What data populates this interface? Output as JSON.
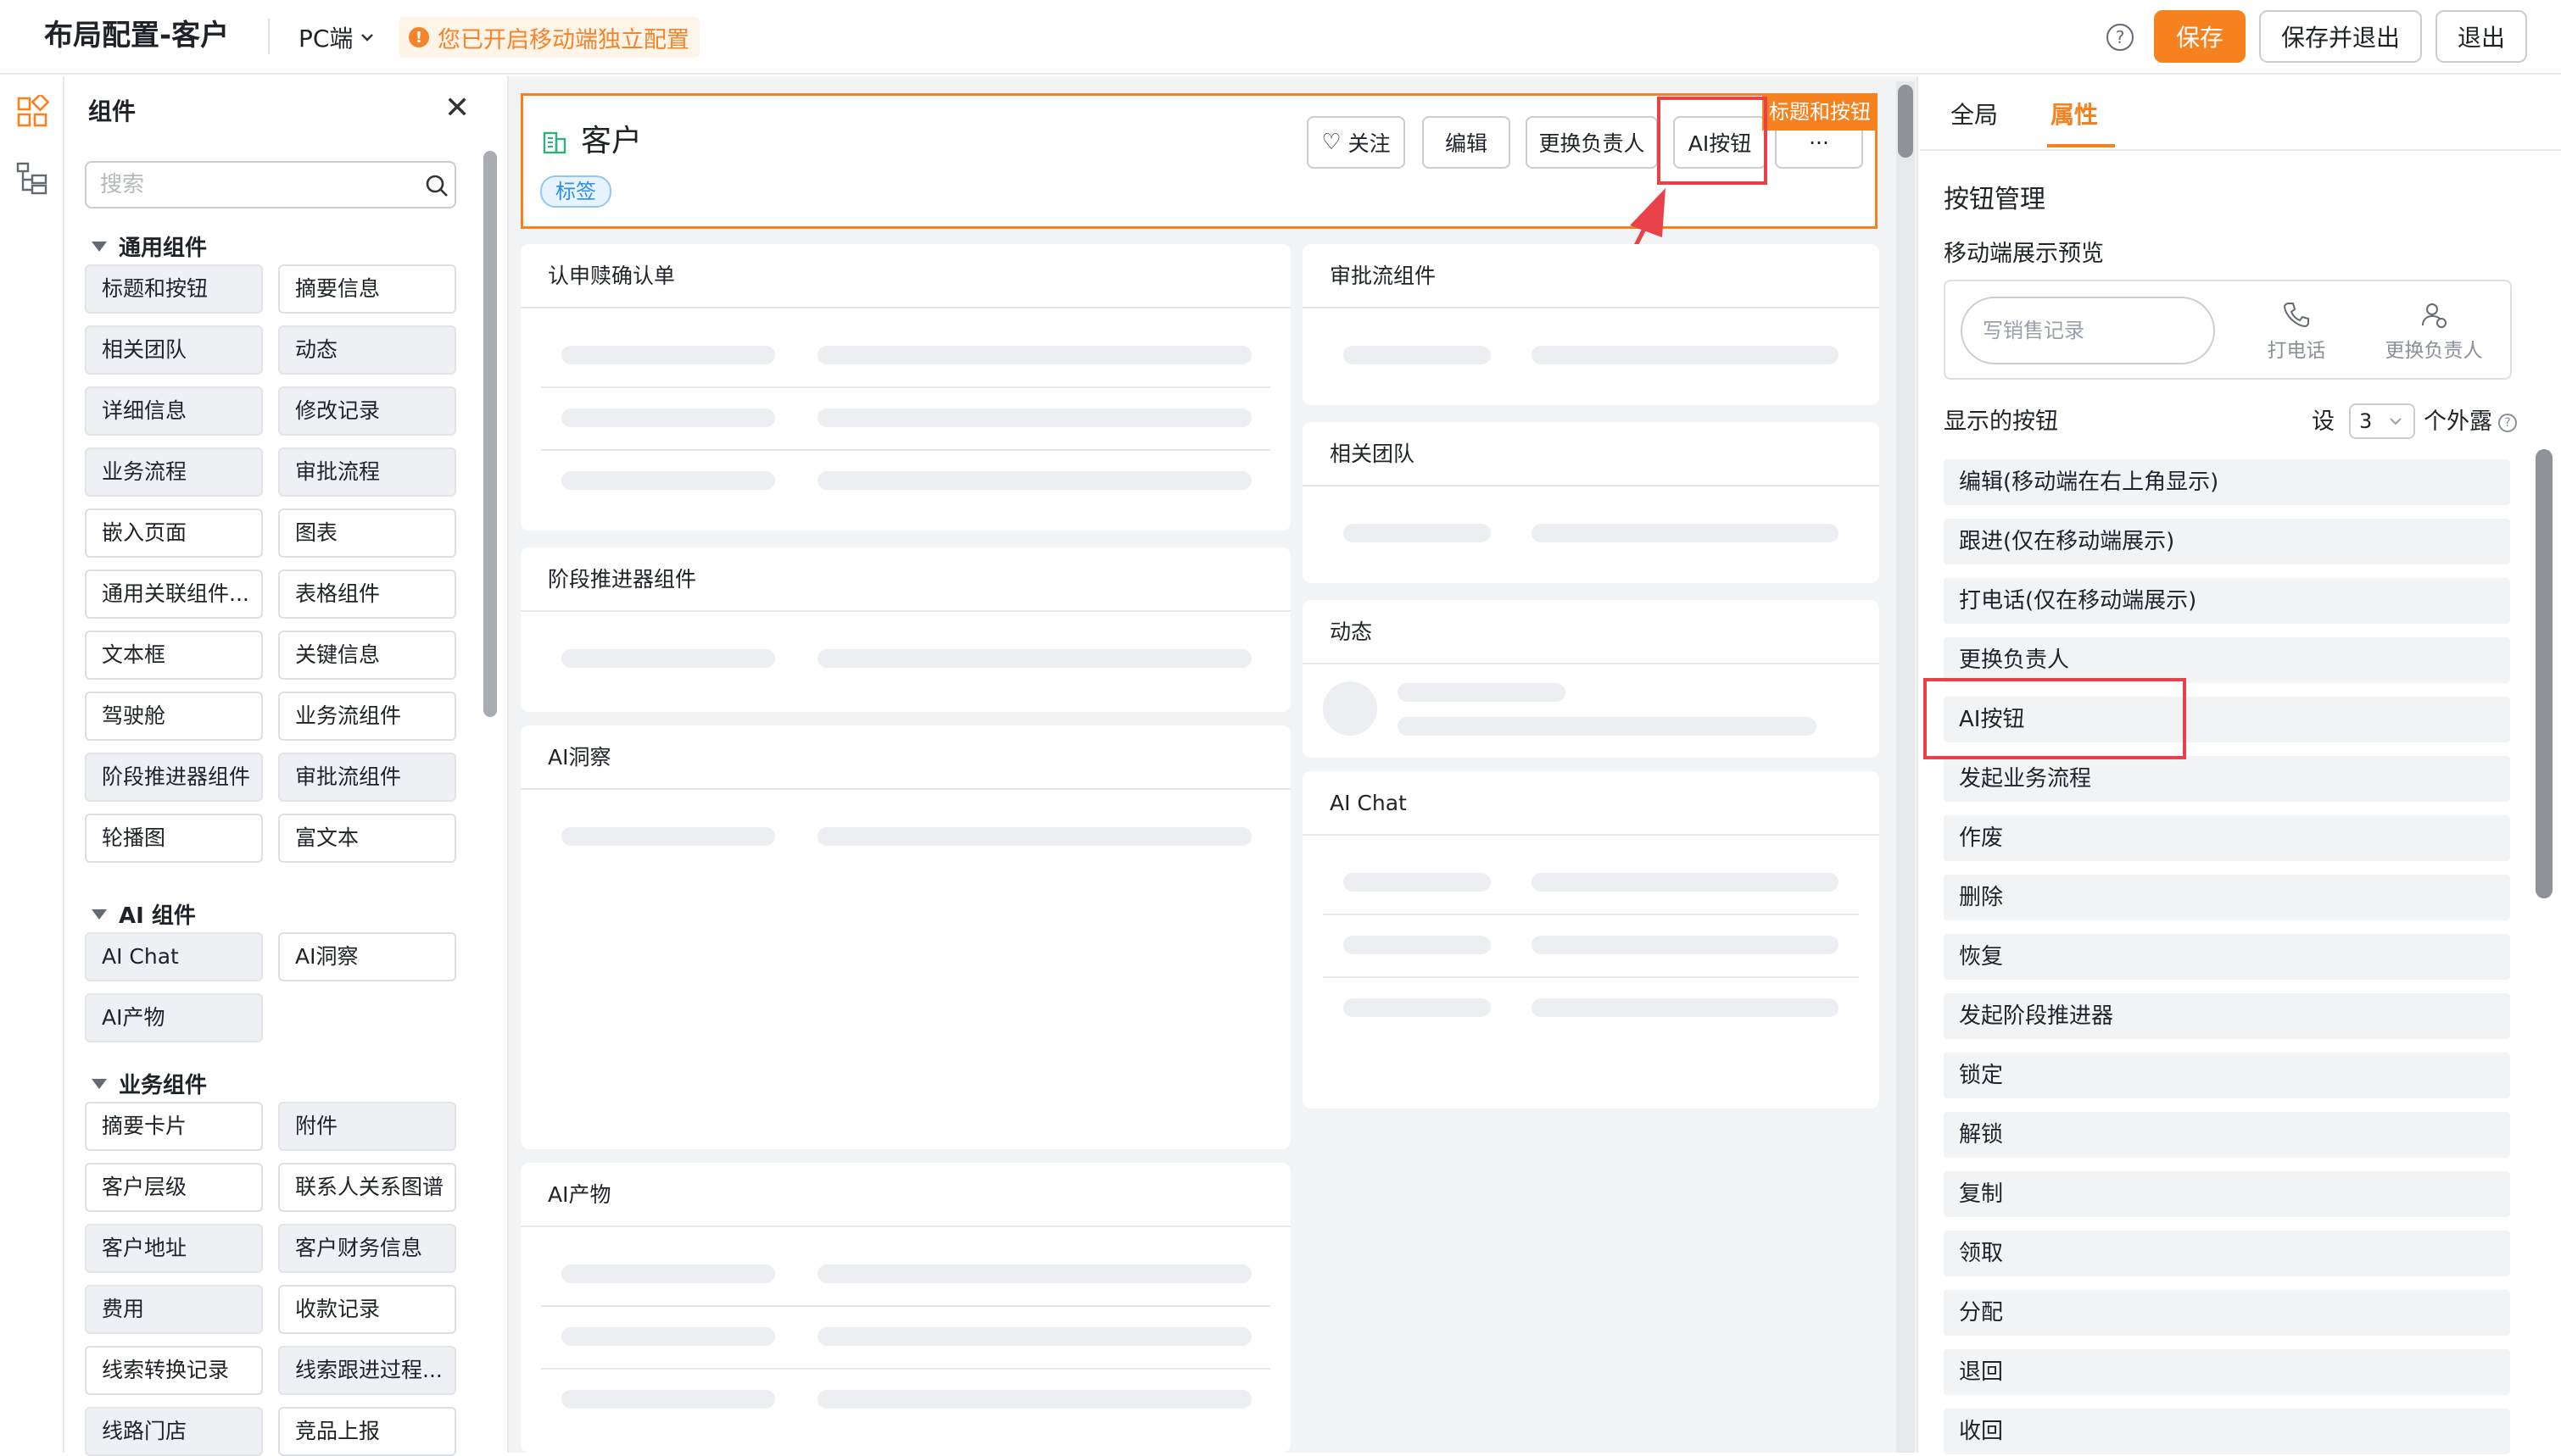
{
  "topbar": {
    "title": "布局配置-客户",
    "platform": "PC端",
    "mobile_notice": "您已开启移动端独立配置",
    "buttons": {
      "save": "保存",
      "save_exit": "保存并退出",
      "exit": "退出"
    },
    "colors": {
      "accent": "#f5821f",
      "warn_bg": "#fff4e8"
    }
  },
  "left_panel": {
    "title": "组件",
    "search_placeholder": "搜索",
    "groups": [
      {
        "name": "通用组件",
        "items": [
          {
            "label": "标题和按钮",
            "used": true
          },
          {
            "label": "摘要信息",
            "used": false
          },
          {
            "label": "相关团队",
            "used": true
          },
          {
            "label": "动态",
            "used": true
          },
          {
            "label": "详细信息",
            "used": true
          },
          {
            "label": "修改记录",
            "used": true
          },
          {
            "label": "业务流程",
            "used": true
          },
          {
            "label": "审批流程",
            "used": true
          },
          {
            "label": "嵌入页面",
            "used": false
          },
          {
            "label": "图表",
            "used": false
          },
          {
            "label": "通用关联组件...",
            "used": false
          },
          {
            "label": "表格组件",
            "used": false
          },
          {
            "label": "文本框",
            "used": false
          },
          {
            "label": "关键信息",
            "used": false
          },
          {
            "label": "驾驶舱",
            "used": false
          },
          {
            "label": "业务流组件",
            "used": false
          },
          {
            "label": "阶段推进器组件",
            "used": true
          },
          {
            "label": "审批流组件",
            "used": true
          },
          {
            "label": "轮播图",
            "used": false
          },
          {
            "label": "富文本",
            "used": false
          }
        ]
      },
      {
        "name": "AI 组件",
        "items": [
          {
            "label": "AI Chat",
            "used": true
          },
          {
            "label": "AI洞察",
            "used": false
          },
          {
            "label": "AI产物",
            "used": true
          }
        ]
      },
      {
        "name": "业务组件",
        "items": [
          {
            "label": "摘要卡片",
            "used": false
          },
          {
            "label": "附件",
            "used": true
          },
          {
            "label": "客户层级",
            "used": false
          },
          {
            "label": "联系人关系图谱",
            "used": false
          },
          {
            "label": "客户地址",
            "used": true
          },
          {
            "label": "客户财务信息",
            "used": true
          },
          {
            "label": "费用",
            "used": true
          },
          {
            "label": "收款记录",
            "used": false
          },
          {
            "label": "线索转换记录",
            "used": false
          },
          {
            "label": "线索跟进过程...",
            "used": true
          },
          {
            "label": "线路门店",
            "used": true
          },
          {
            "label": "竞品上报",
            "used": false
          }
        ]
      }
    ]
  },
  "canvas": {
    "header": {
      "name": "客户",
      "tag": "标签",
      "badge": "标题和按钮",
      "buttons": {
        "follow": "关注",
        "edit": "编辑",
        "change_owner": "更换负责人",
        "ai": "AI按钮",
        "more": "···"
      }
    },
    "cards": {
      "left1": "认申赎确认单",
      "left2": "阶段推进器组件",
      "left3": "AI洞察",
      "left4": "AI产物",
      "right1": "审批流组件",
      "right2": "相关团队",
      "right3": "动态",
      "right4": "AI Chat"
    }
  },
  "right_panel": {
    "tabs": {
      "global": "全局",
      "props": "属性"
    },
    "section_title": "按钮管理",
    "preview_title": "移动端展示预览",
    "preview": {
      "input": "写销售记录",
      "call": "打电话",
      "change_owner": "更换负责人"
    },
    "show_buttons": {
      "label": "显示的按钮",
      "prefix": "设",
      "count": "3",
      "suffix": "个外露"
    },
    "buttons": [
      "编辑(移动端在右上角显示)",
      "跟进(仅在移动端展示)",
      "打电话(仅在移动端展示)",
      "更换负责人",
      "AI按钮",
      "发起业务流程",
      "作废",
      "删除",
      "恢复",
      "发起阶段推进器",
      "锁定",
      "解锁",
      "复制",
      "领取",
      "分配",
      "退回",
      "收回"
    ]
  }
}
